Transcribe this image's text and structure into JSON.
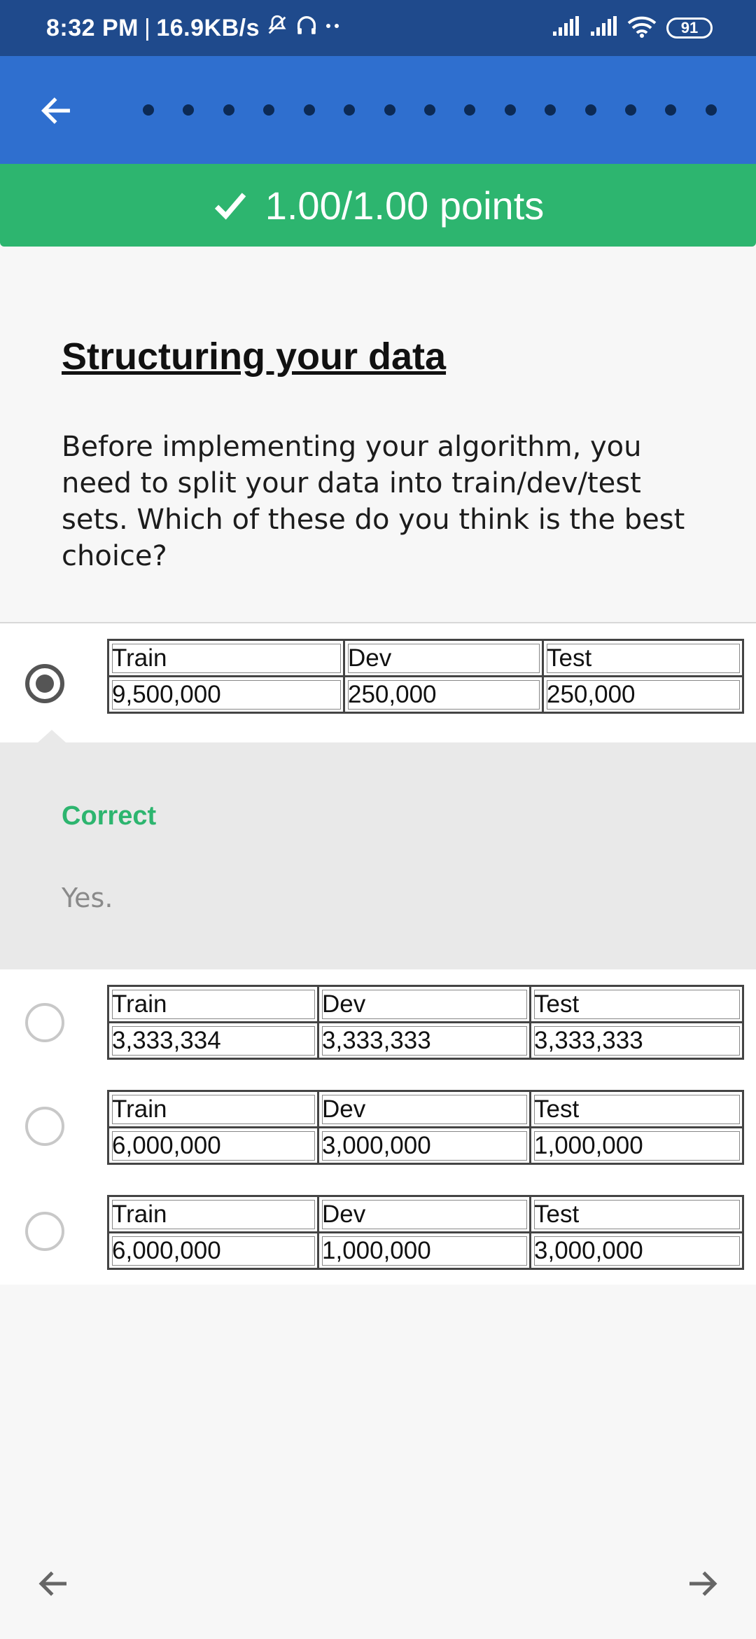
{
  "status_bar": {
    "time": "8:32 PM",
    "separator": "|",
    "speed": "16.9KB/s",
    "battery": "91",
    "icons": [
      "mute-icon",
      "headphones-icon",
      "signal-icon",
      "signal-icon",
      "wifi-icon",
      "battery-icon"
    ]
  },
  "header": {
    "back_icon": "arrow-left-icon",
    "progress_dot_count": 15
  },
  "score": {
    "icon": "check-icon",
    "text": "1.00/1.00 points",
    "color": "#2db56f"
  },
  "question": {
    "title": "Structuring your data",
    "text": "Before implementing your algorithm, you need to split your data into train/dev/test sets. Which of these do you think is the best choice?"
  },
  "options": [
    {
      "selected": true,
      "headers": [
        "Train",
        "Dev",
        "Test"
      ],
      "values": [
        "9,500,000",
        "250,000",
        "250,000"
      ]
    },
    {
      "selected": false,
      "headers": [
        "Train",
        "Dev",
        "Test"
      ],
      "values": [
        "3,333,334",
        "3,333,333",
        "3,333,333"
      ]
    },
    {
      "selected": false,
      "headers": [
        "Train",
        "Dev",
        "Test"
      ],
      "values": [
        "6,000,000",
        "3,000,000",
        "1,000,000"
      ]
    },
    {
      "selected": false,
      "headers": [
        "Train",
        "Dev",
        "Test"
      ],
      "values": [
        "6,000,000",
        "1,000,000",
        "3,000,000"
      ]
    }
  ],
  "feedback": {
    "title": "Correct",
    "text": "Yes."
  },
  "nav": {
    "prev_icon": "arrow-left-icon",
    "next_icon": "arrow-right-icon"
  },
  "colors": {
    "status_bar": "#1f4a8c",
    "app_bar": "#2f6fcf",
    "correct": "#2db56f"
  }
}
